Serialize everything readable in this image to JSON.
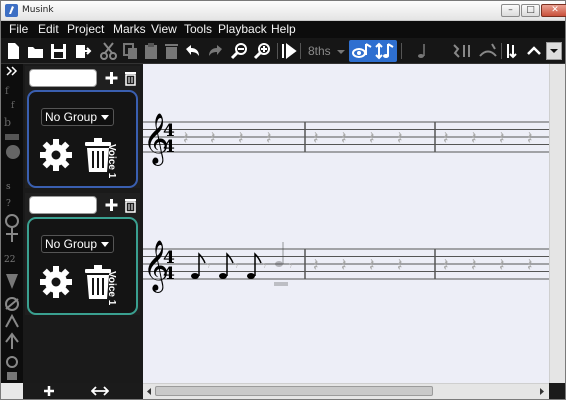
{
  "window": {
    "title": "Musink"
  },
  "menubar": {
    "items": [
      "File",
      "Edit",
      "Project",
      "Marks",
      "View",
      "Tools",
      "Playback",
      "Help"
    ]
  },
  "toolbar": {
    "note_value": "8ths"
  },
  "staves": [
    {
      "group": "No Group",
      "voice": "Voice 1",
      "border_color": "#3a5fb0"
    },
    {
      "group": "No Group",
      "voice": "Voice 1",
      "border_color": "#3aa090"
    }
  ],
  "score": {
    "time_signature_top": "4",
    "time_signature_bottom": "4"
  },
  "colors": {
    "menubar": "#0c0c0c",
    "toolbar": "#161616",
    "score_background": "#edeef7",
    "active_button": "#2e6fd0"
  }
}
